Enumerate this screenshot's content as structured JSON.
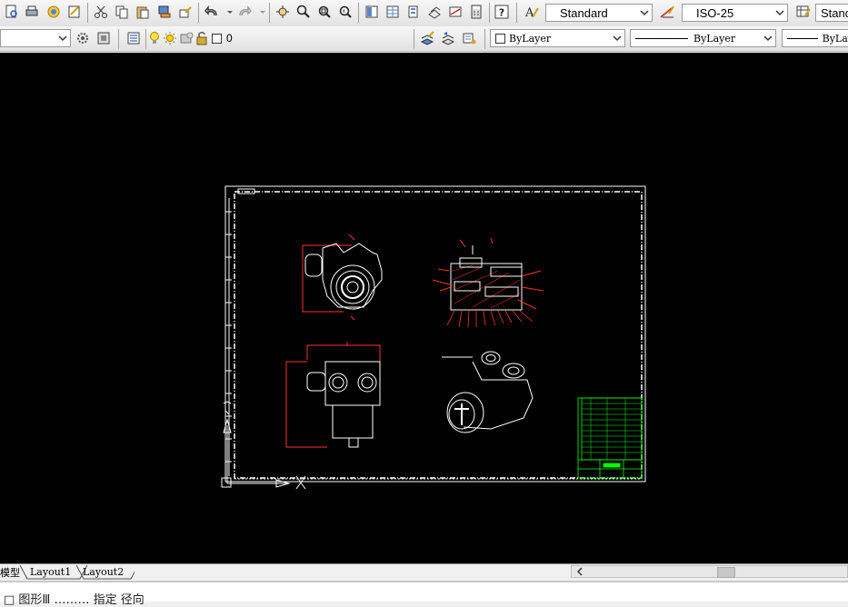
{
  "toolbar_standard": {
    "icons": [
      "qnew-icon",
      "plot-icon",
      "plot-preview-icon",
      "publish-icon",
      "cut-icon",
      "copy-icon",
      "paste-icon",
      "match-properties-icon",
      "block-editor-icon",
      "undo-icon",
      "redo-icon",
      "pan-icon",
      "zoom-realtime-icon",
      "zoom-window-icon",
      "zoom-previous-icon",
      "properties-icon",
      "design-center-icon",
      "tool-palettes-icon",
      "sheet-set-icon",
      "markup-icon",
      "quickcalc-icon",
      "help-icon"
    ],
    "text_style": "Standard",
    "dim_style": "ISO-25",
    "table_style": "Standard"
  },
  "toolbar_layers": {
    "layer_state": "0",
    "color": "ByLayer",
    "linetype": "ByLayer",
    "lineweight": "ByLay"
  },
  "layout_tabs": [
    "模型",
    "Layout1",
    "Layout2"
  ],
  "command_line": {
    "text": "□ 图形Ⅲ ……… 指定 径向"
  },
  "colors": {
    "canvas": "#000000",
    "drawing_lines": "#ffffff",
    "annotation": "#ff0000",
    "title_block": "#00ff00"
  }
}
